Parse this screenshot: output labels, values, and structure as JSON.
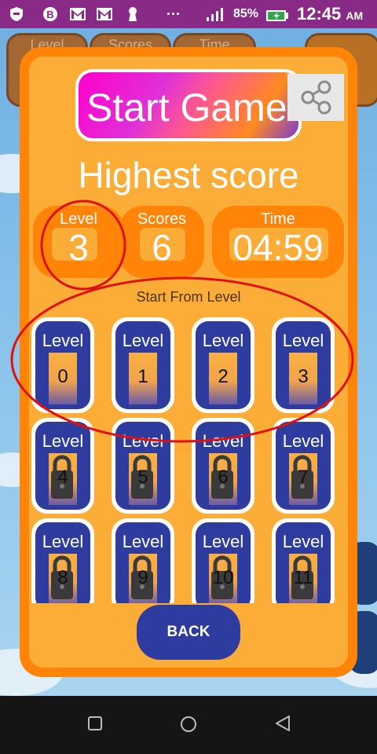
{
  "status_bar": {
    "battery_percent": "85%",
    "time": "12:45",
    "ampm": "AM",
    "dots": "···",
    "icons": [
      "shield-icon",
      "b-badge-icon",
      "gmail-icon",
      "gmail-icon",
      "keyhole-icon",
      "signal-icon",
      "battery-icon"
    ]
  },
  "background_chips": [
    "Level",
    "Scores",
    "Time"
  ],
  "dialog": {
    "start_game_label": "Start Game",
    "highest_title": "Highest score",
    "stats": [
      {
        "label": "Level",
        "value": "3"
      },
      {
        "label": "Scores",
        "value": "6"
      },
      {
        "label": "Time",
        "value": "04:59"
      }
    ],
    "start_from_label": "Start From Level",
    "level_label": "Level",
    "levels": [
      {
        "num": "0",
        "locked": false
      },
      {
        "num": "1",
        "locked": false
      },
      {
        "num": "2",
        "locked": false
      },
      {
        "num": "3",
        "locked": false
      },
      {
        "num": "4",
        "locked": true
      },
      {
        "num": "5",
        "locked": true
      },
      {
        "num": "6",
        "locked": true
      },
      {
        "num": "7",
        "locked": true
      },
      {
        "num": "8",
        "locked": true
      },
      {
        "num": "9",
        "locked": true
      },
      {
        "num": "10",
        "locked": true
      },
      {
        "num": "11",
        "locked": true
      }
    ],
    "back_label": "BACK"
  },
  "colors": {
    "dialog_border": "#ff8408",
    "dialog_fill": "#fcad38",
    "tile_blue": "#2d3c9e",
    "annotation_red": "#e01010"
  }
}
